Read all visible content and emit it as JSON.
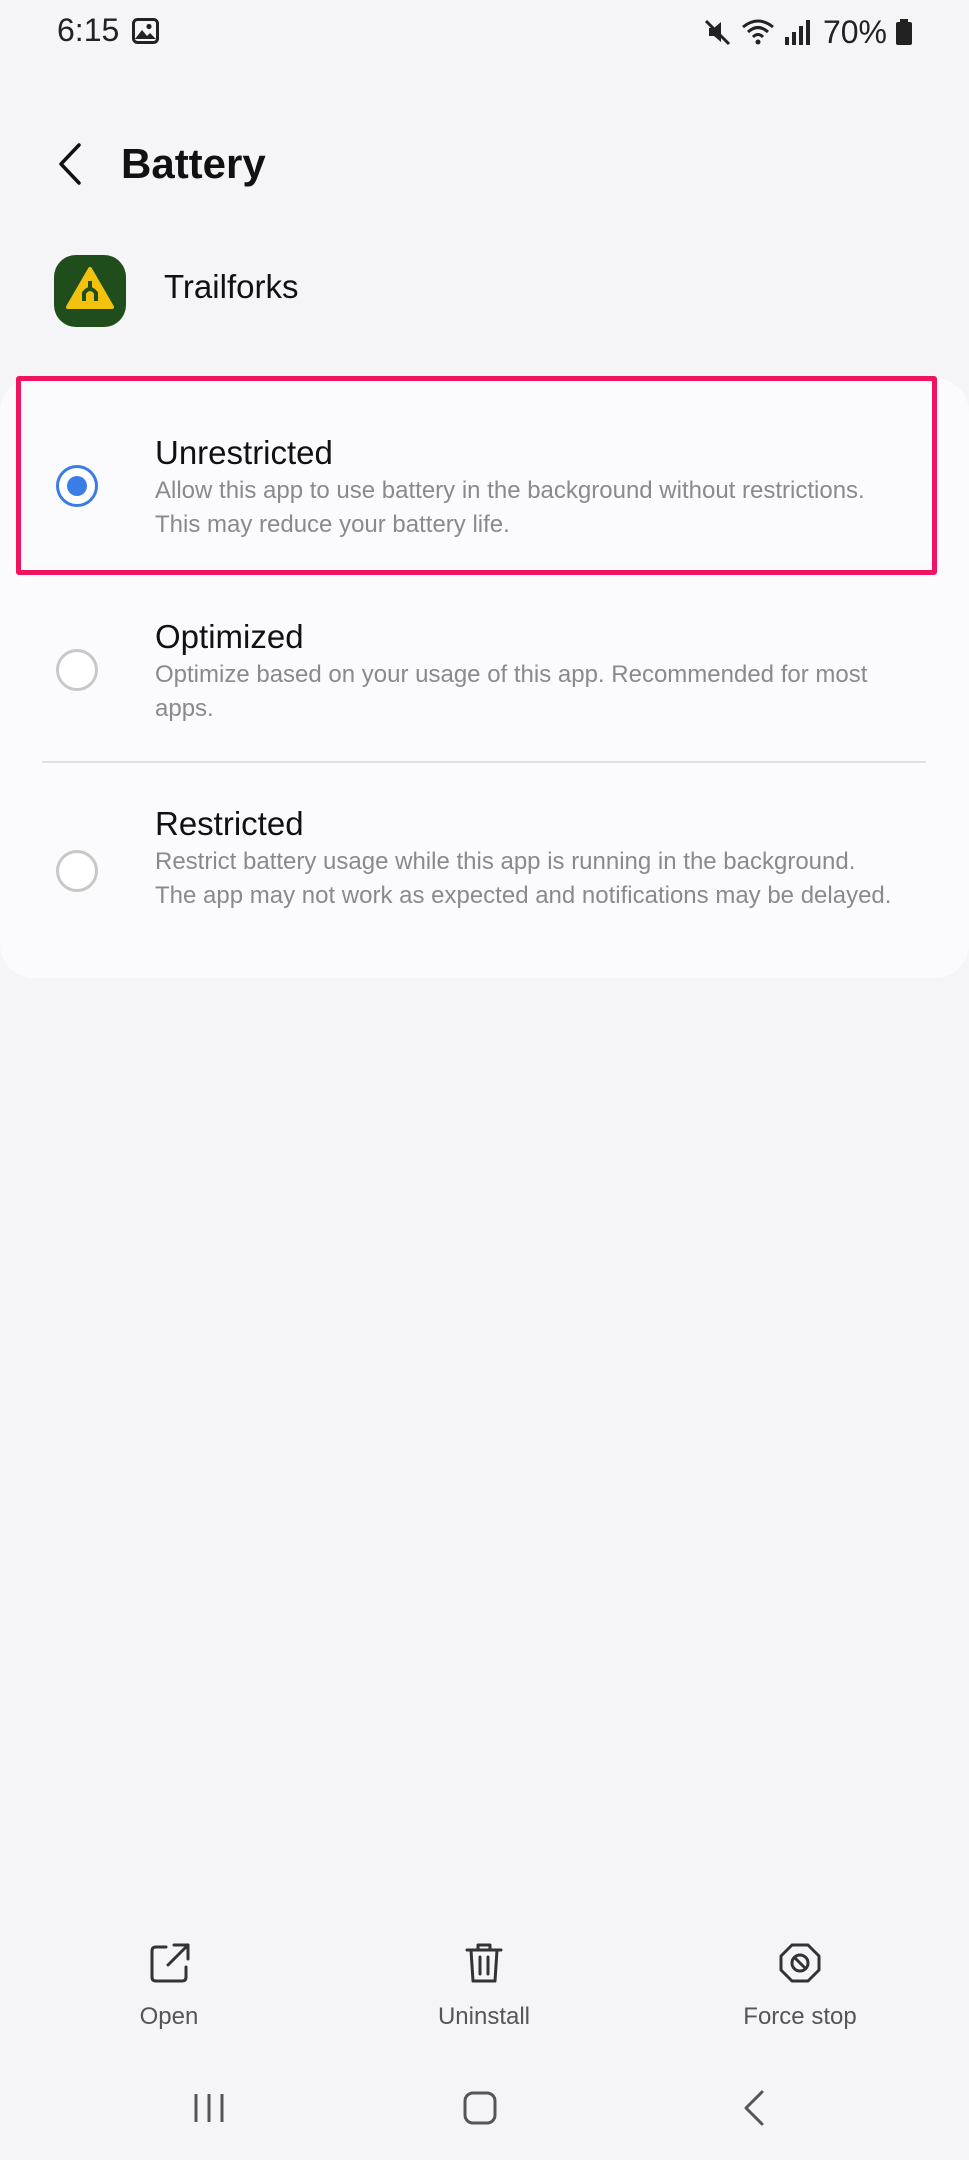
{
  "status_bar": {
    "time": "6:15",
    "battery_percent": "70%",
    "icons": [
      "gallery-icon",
      "mute-icon",
      "wifi-icon",
      "signal-icon",
      "battery-icon"
    ]
  },
  "header": {
    "title": "Battery",
    "back_icon": "back-arrow-icon"
  },
  "app": {
    "name": "Trailforks",
    "icon": "trailforks-app-icon"
  },
  "battery_options": [
    {
      "title": "Unrestricted",
      "description": "Allow this app to use battery in the background without restrictions. This may reduce your battery life.",
      "selected": true
    },
    {
      "title": "Optimized",
      "description": "Optimize based on your usage of this app. Recommended for most apps.",
      "selected": false
    },
    {
      "title": "Restricted",
      "description": "Restrict battery usage while this app is running in the background. The app may not work as expected and notifications may be delayed.",
      "selected": false
    }
  ],
  "bottom_actions": [
    {
      "label": "Open",
      "icon": "open-external-icon"
    },
    {
      "label": "Uninstall",
      "icon": "trash-icon"
    },
    {
      "label": "Force stop",
      "icon": "force-stop-icon"
    }
  ],
  "nav_bar": [
    "recents-icon",
    "home-icon",
    "back-icon"
  ],
  "colors": {
    "accent": "#3b7de6",
    "highlight": "#f0145e",
    "background": "#f5f5f8",
    "card": "#fbfbfd"
  }
}
